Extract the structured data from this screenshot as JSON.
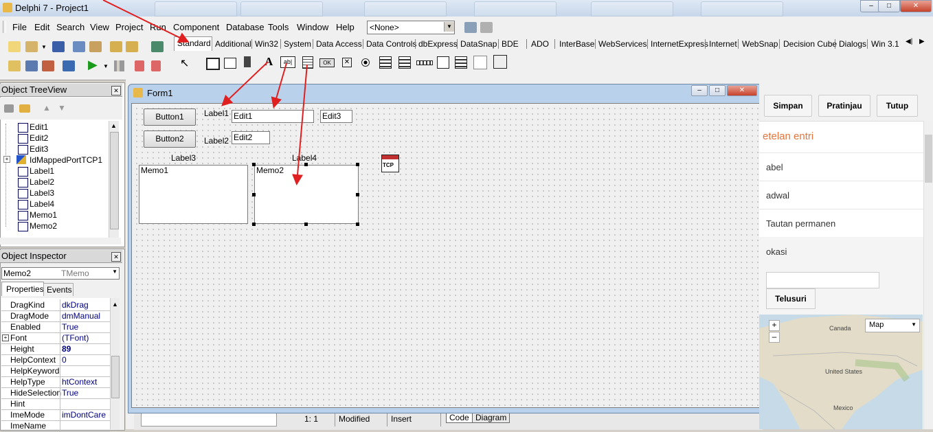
{
  "window": {
    "title": "Delphi 7 - Project1"
  },
  "menu": [
    "File",
    "Edit",
    "Search",
    "View",
    "Project",
    "Run",
    "Component",
    "Database",
    "Tools",
    "Window",
    "Help"
  ],
  "toolbar": {
    "config_combo": "<None>"
  },
  "palette_tabs": [
    "Standard",
    "Additional",
    "Win32",
    "System",
    "Data Access",
    "Data Controls",
    "dbExpress",
    "DataSnap",
    "BDE",
    "ADO",
    "InterBase",
    "WebServices",
    "InternetExpress",
    "Internet",
    "WebSnap",
    "Decision Cube",
    "Dialogs",
    "Win 3.1"
  ],
  "treeview": {
    "title": "Object TreeView",
    "items": [
      "Edit1",
      "Edit2",
      "Edit3",
      "IdMappedPortTCP1",
      "Label1",
      "Label2",
      "Label3",
      "Label4",
      "Memo1",
      "Memo2"
    ]
  },
  "inspector": {
    "title": "Object Inspector",
    "selected_object": "Memo2",
    "selected_type": "TMemo",
    "tabs": [
      "Properties",
      "Events"
    ],
    "rows": [
      {
        "name": "DragKind",
        "value": "dkDrag"
      },
      {
        "name": "DragMode",
        "value": "dmManual"
      },
      {
        "name": "Enabled",
        "value": "True"
      },
      {
        "name": "Font",
        "value": "(TFont)"
      },
      {
        "name": "Height",
        "value": "89"
      },
      {
        "name": "HelpContext",
        "value": "0"
      },
      {
        "name": "HelpKeyword",
        "value": ""
      },
      {
        "name": "HelpType",
        "value": "htContext"
      },
      {
        "name": "HideSelection",
        "value": "True"
      },
      {
        "name": "Hint",
        "value": ""
      },
      {
        "name": "ImeMode",
        "value": "imDontCare"
      },
      {
        "name": "ImeName",
        "value": ""
      }
    ]
  },
  "form": {
    "title": "Form1",
    "button1": "Button1",
    "button2": "Button2",
    "label1": "Label1",
    "label2": "Label2",
    "label3": "Label3",
    "label4": "Label4",
    "edit1": "Edit1",
    "edit2": "Edit2",
    "edit3": "Edit3",
    "memo1": "Memo1",
    "memo2": "Memo2",
    "tcp_icon": "TCP"
  },
  "editor_status": {
    "position": "1:   1",
    "modified": "Modified",
    "mode": "Insert",
    "tabs": [
      "Code",
      "Diagram"
    ]
  },
  "blogger": {
    "buttons": [
      "Simpan",
      "Pratinjau",
      "Tutup"
    ],
    "settings_title": "etelan entri",
    "items": [
      "abel",
      "adwal",
      "Tautan permanen",
      "okasi"
    ],
    "search_button": "Telusuri",
    "map_type": "Map",
    "map_labels": [
      "Canada",
      "United States",
      "Mexico"
    ]
  },
  "colors": {
    "accent": "#e8743b",
    "arrow": "#e02020",
    "title_bar": "#c7d6ea"
  }
}
